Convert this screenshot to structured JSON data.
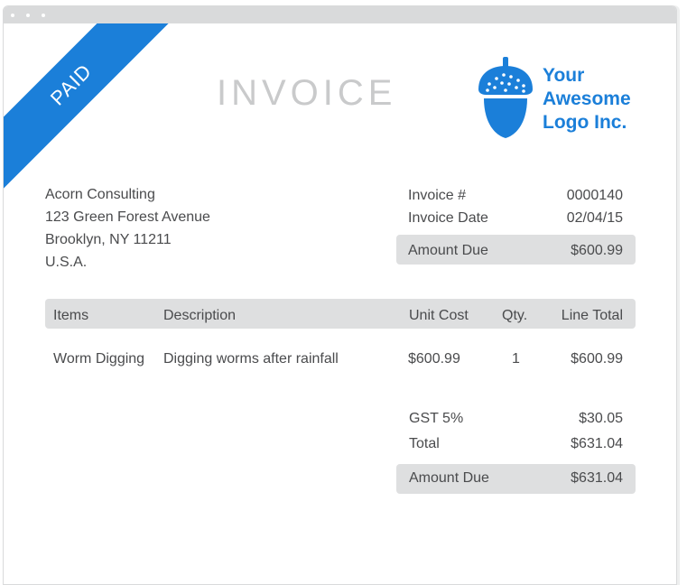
{
  "ribbon": {
    "label": "PAID",
    "color": "#1b7fd9"
  },
  "title": "INVOICE",
  "logo": {
    "icon": "acorn-icon",
    "lines": [
      "Your",
      "Awesome",
      "Logo Inc."
    ]
  },
  "client": {
    "lines": [
      "Acorn Consulting",
      "123 Green Forest Avenue",
      "Brooklyn, NY 11211",
      "U.S.A."
    ]
  },
  "meta": {
    "invoice_number_label": "Invoice #",
    "invoice_number": "0000140",
    "invoice_date_label": "Invoice Date",
    "invoice_date": "02/04/15",
    "amount_due_label": "Amount Due",
    "amount_due": "$600.99"
  },
  "table": {
    "headers": {
      "items": "Items",
      "description": "Description",
      "unit_cost": "Unit Cost",
      "qty": "Qty.",
      "line_total": "Line Total"
    },
    "rows": [
      {
        "item": "Worm Digging",
        "description": "Digging worms after rainfall",
        "unit_cost": "$600.99",
        "qty": "1",
        "line_total": "$600.99"
      }
    ]
  },
  "totals": {
    "gst_label": "GST 5%",
    "gst_value": "$30.05",
    "total_label": "Total",
    "total_value": "$631.04",
    "amount_due_label": "Amount Due",
    "amount_due_value": "$631.04"
  }
}
